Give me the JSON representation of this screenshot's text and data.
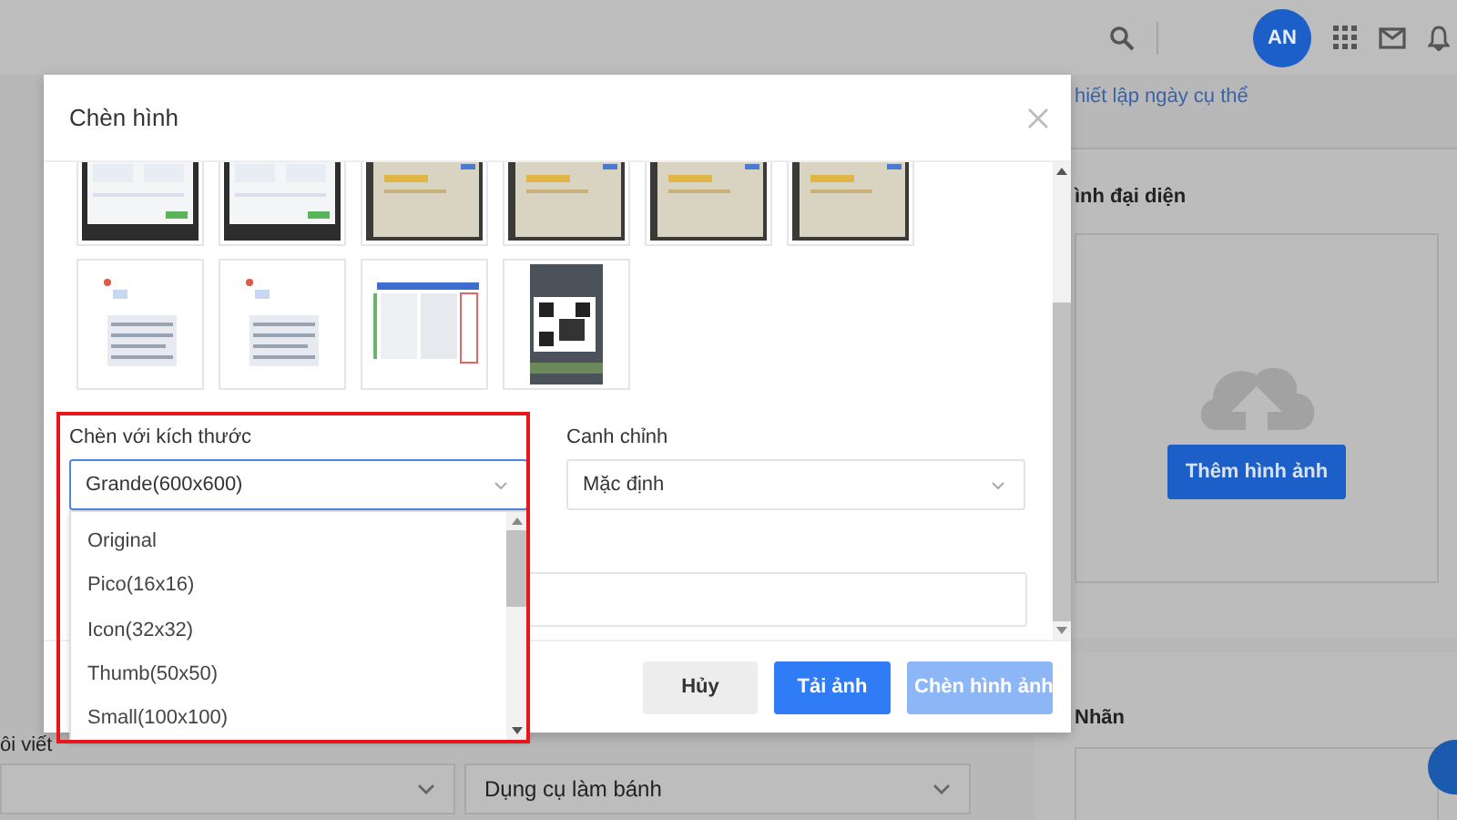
{
  "backdrop": {
    "topbar": {
      "avatar": "AN"
    },
    "schedule_link": "hiết lập ngày cụ thể",
    "featured_image": {
      "title": "ình đại diện",
      "button": "Thêm hình ảnh"
    },
    "labels_card": {
      "title": "Nhãn"
    },
    "post_label": "ôi viết",
    "category_select": "Dụng cụ làm bánh"
  },
  "dialog": {
    "title": "Chèn hình",
    "size": {
      "label": "Chèn với kích thước",
      "value": "Grande(600x600)",
      "highlighted": true,
      "expanded": true,
      "options": [
        "Original",
        "Pico(16x16)",
        "Icon(32x32)",
        "Thumb(50x50)",
        "Small(100x100)"
      ]
    },
    "align": {
      "label": "Canh chỉnh",
      "value": "Mặc định"
    },
    "buttons": [
      {
        "label": "Hủy",
        "kind": "secondary",
        "disabled": false
      },
      {
        "label": "Tải ảnh",
        "kind": "primary",
        "disabled": false
      },
      {
        "label": "Chèn hình ảnh",
        "kind": "primary",
        "disabled": true
      }
    ]
  }
}
